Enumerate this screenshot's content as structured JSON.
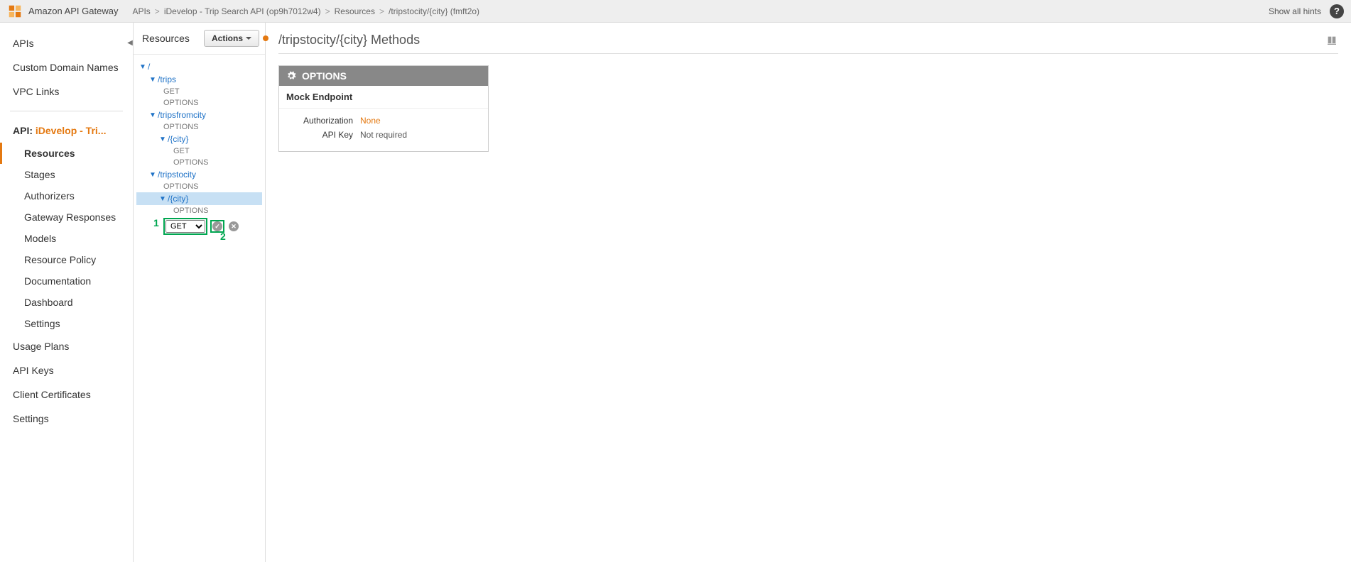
{
  "topbar": {
    "service": "Amazon API Gateway",
    "show_hints": "Show all hints",
    "breadcrumbs": [
      "APIs",
      "iDevelop - Trip Search API (op9h7012w4)",
      "Resources",
      "/tripstocity/{city} (fmft2o)"
    ]
  },
  "sidebar": {
    "apis": "APIs",
    "custom_domains": "Custom Domain Names",
    "vpc_links": "VPC Links",
    "api_prefix": "API:",
    "api_name": "iDevelop - Tri...",
    "resources": "Resources",
    "stages": "Stages",
    "authorizers": "Authorizers",
    "gateway_responses": "Gateway Responses",
    "models": "Models",
    "resource_policy": "Resource Policy",
    "documentation": "Documentation",
    "dashboard": "Dashboard",
    "settings": "Settings",
    "usage_plans": "Usage Plans",
    "api_keys": "API Keys",
    "client_certs": "Client Certificates",
    "global_settings": "Settings"
  },
  "resources": {
    "title": "Resources",
    "actions": "Actions",
    "root": "/",
    "trips": "/trips",
    "get": "GET",
    "options": "OPTIONS",
    "tripsfromcity": "/tripsfromcity",
    "city": "/{city}",
    "tripstocity": "/tripstocity",
    "method_select_value": "GET",
    "annotation1": "1",
    "annotation2": "2"
  },
  "main": {
    "title": "/tripstocity/{city} Methods",
    "card_title": "OPTIONS",
    "card_subtitle": "Mock Endpoint",
    "authorization_k": "Authorization",
    "authorization_v": "None",
    "apikey_k": "API Key",
    "apikey_v": "Not required"
  }
}
